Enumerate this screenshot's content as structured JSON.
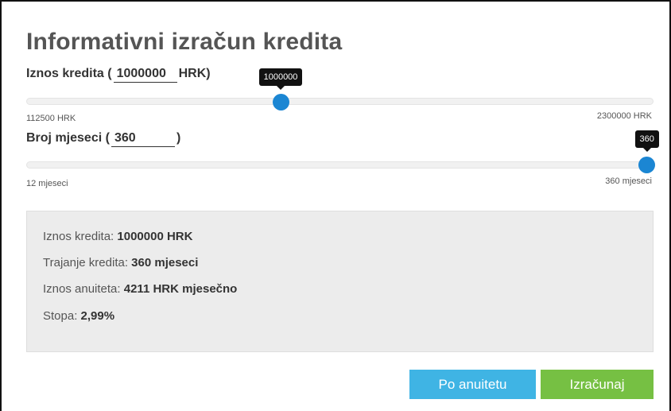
{
  "title": "Informativni izračun kredita",
  "loan_amount": {
    "label_prefix": "Iznos kredita (",
    "value": "1000000",
    "label_suffix": "HRK)",
    "tooltip": "1000000",
    "min_label": "112500 HRK",
    "max_label": "2300000 HRK",
    "min": 112500,
    "max": 2300000,
    "current": 1000000
  },
  "months": {
    "label_prefix": "Broj mjeseci (",
    "value": "360",
    "label_suffix": ")",
    "tooltip": "360",
    "min_label": "12 mjeseci",
    "max_label": "360 mjeseci",
    "min": 12,
    "max": 360,
    "current": 360
  },
  "results": {
    "amount_label": "Iznos kredita:",
    "amount_value": "1000000 HRK",
    "duration_label": "Trajanje kredita:",
    "duration_value": "360 mjeseci",
    "annuity_label": "Iznos anuiteta:",
    "annuity_value": "4211 HRK mjesečno",
    "rate_label": "Stopa:",
    "rate_value": "2,99%"
  },
  "buttons": {
    "annuity": "Po anuitetu",
    "calculate": "Izračunaj"
  },
  "colors": {
    "handle": "#1b86d3",
    "button_blue": "#3fb4e4",
    "button_green": "#76c043"
  }
}
